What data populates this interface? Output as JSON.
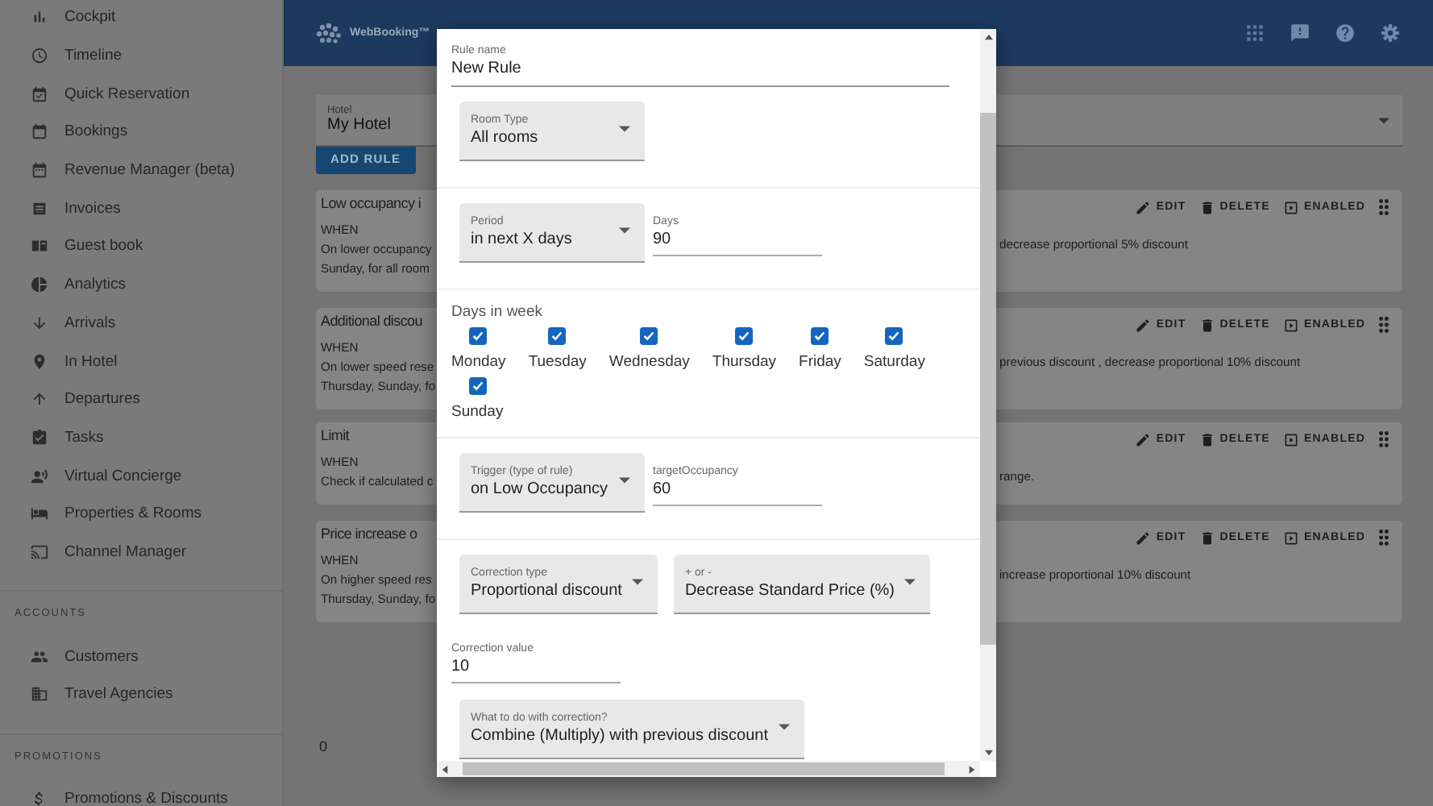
{
  "app_bar": {
    "logo_text": "WebBooking™"
  },
  "sidebar": {
    "items": [
      {
        "label": "Cockpit"
      },
      {
        "label": "Timeline"
      },
      {
        "label": "Quick Reservation"
      },
      {
        "label": "Bookings"
      },
      {
        "label": "Revenue Manager (beta)"
      },
      {
        "label": "Invoices"
      },
      {
        "label": "Guest book"
      },
      {
        "label": "Analytics"
      },
      {
        "label": "Arrivals"
      },
      {
        "label": "In Hotel"
      },
      {
        "label": "Departures"
      },
      {
        "label": "Tasks"
      },
      {
        "label": "Virtual Concierge"
      },
      {
        "label": "Properties & Rooms"
      },
      {
        "label": "Channel Manager"
      }
    ],
    "groups": [
      {
        "heading": "ACCOUNTS",
        "items": [
          {
            "label": "Customers"
          },
          {
            "label": "Travel Agencies"
          }
        ]
      },
      {
        "heading": "PROMOTIONS",
        "items": [
          {
            "label": "Promotions & Discounts"
          }
        ]
      }
    ]
  },
  "hotel_select": {
    "label": "Hotel",
    "value": "My Hotel"
  },
  "add_rule_button": "ADD RULE",
  "rules": [
    {
      "title": "Low occupancy i",
      "when": "WHEN",
      "line_1_start": "On lower occupancy",
      "line_1_end": "decrease proportional 5% discount",
      "line_2_start": "Sunday, for all room",
      "edit": "EDIT",
      "delete": "DELETE",
      "enabled": "ENABLED"
    },
    {
      "title": "Additional discou",
      "when": "WHEN",
      "line_1_start": "On lower speed rese",
      "line_1_end": "previous discount , decrease proportional 10% discount",
      "line_2_start": "Thursday, Sunday, fo",
      "edit": "EDIT",
      "delete": "DELETE",
      "enabled": "ENABLED"
    },
    {
      "title": "Limit",
      "when": "WHEN",
      "line_1_start": "Check if calculated c",
      "line_1_end": "range.",
      "edit": "EDIT",
      "delete": "DELETE",
      "enabled": "ENABLED"
    },
    {
      "title": "Price increase o",
      "when": "WHEN",
      "line_1_start": "On higher speed res",
      "line_1_end": "increase proportional 10% discount",
      "line_2_start": "Thursday, Sunday, fo",
      "edit": "EDIT",
      "delete": "DELETE",
      "enabled": "ENABLED"
    }
  ],
  "footer_count": "0",
  "dialog": {
    "rule_name": {
      "label": "Rule name",
      "value": "New Rule"
    },
    "sections": [
      {
        "kind": "controls",
        "rows": [
          [
            {
              "kind": "select",
              "label": "Room Type",
              "value": "All rooms"
            }
          ]
        ]
      },
      {
        "kind": "controls",
        "rows": [
          [
            {
              "kind": "select",
              "label": "Period",
              "value": "in next X days"
            },
            {
              "kind": "field",
              "label": "Days",
              "value": "90"
            }
          ]
        ]
      },
      {
        "kind": "days",
        "title": "Days in week",
        "days": [
          {
            "label": "Monday",
            "checked": true
          },
          {
            "label": "Tuesday",
            "checked": true
          },
          {
            "label": "Wednesday",
            "checked": true
          },
          {
            "label": "Thursday",
            "checked": true
          },
          {
            "label": "Friday",
            "checked": true
          },
          {
            "label": "Saturday",
            "checked": true
          },
          {
            "label": "Sunday",
            "checked": true
          }
        ]
      },
      {
        "kind": "controls",
        "rows": [
          [
            {
              "kind": "select",
              "label": "Trigger (type of rule)",
              "value": "on Low Occupancy"
            },
            {
              "kind": "field",
              "label": "targetOccupancy",
              "value": "60"
            }
          ]
        ]
      },
      {
        "kind": "controls",
        "rows": [
          [
            {
              "kind": "select",
              "label": "Correction type",
              "value": "Proportional discount"
            },
            {
              "kind": "select",
              "label": "+ or -",
              "value": "Decrease Standard Price (%)"
            }
          ],
          [
            {
              "kind": "field",
              "label": "Correction value",
              "value": "10"
            }
          ],
          [
            {
              "kind": "select",
              "label": "What to do with correction?",
              "value": "Combine (Multiply) with previous discount"
            }
          ]
        ]
      }
    ]
  }
}
